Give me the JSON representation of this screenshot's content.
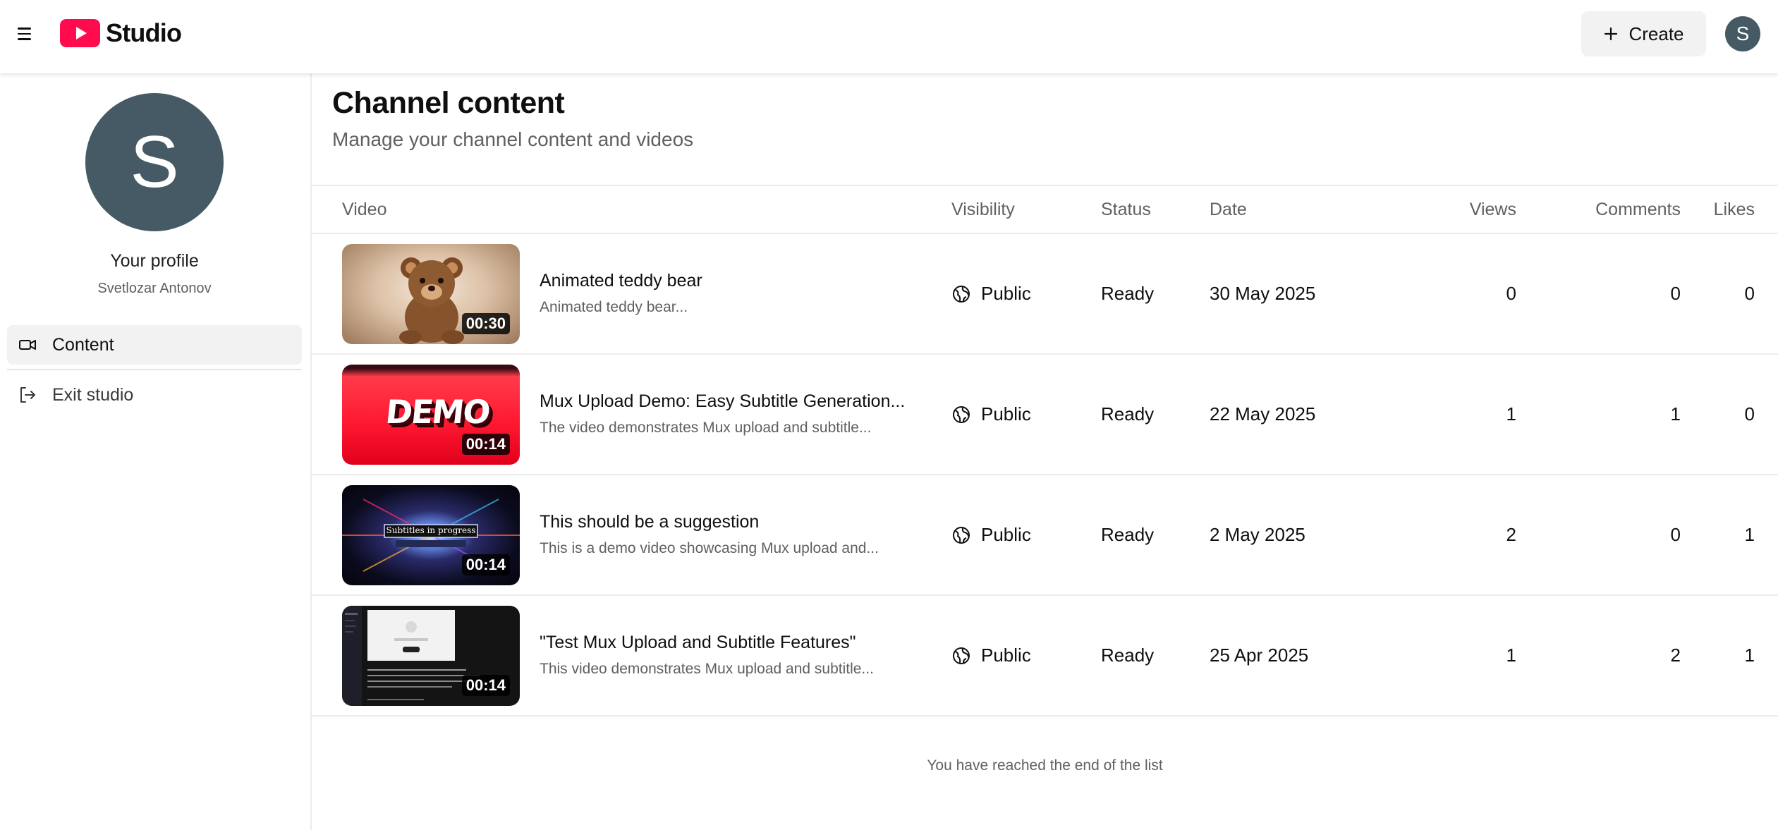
{
  "app": {
    "name": "Studio",
    "create_label": "Create",
    "avatar_initial": "S",
    "brand_color": "#ff0b4e",
    "avatar_color": "#455a64"
  },
  "sidebar": {
    "profile_initial": "S",
    "profile_label": "Your profile",
    "profile_name": "Svetlozar Antonov",
    "items": [
      {
        "label": "Content",
        "icon": "video-camera-icon",
        "active": true
      },
      {
        "label": "Exit studio",
        "icon": "exit-icon",
        "active": false
      }
    ]
  },
  "main": {
    "title": "Channel content",
    "subtitle": "Manage your channel content and videos",
    "columns": {
      "video": "Video",
      "visibility": "Visibility",
      "status": "Status",
      "date": "Date",
      "views": "Views",
      "comments": "Comments",
      "likes": "Likes"
    },
    "rows": [
      {
        "title": "Animated teddy bear",
        "description": "Animated teddy bear...",
        "duration": "00:30",
        "thumbnail": "teddy-bear-thumbnail",
        "visibility": "Public",
        "status": "Ready",
        "date": "30 May 2025",
        "views": "0",
        "comments": "0",
        "likes": "0"
      },
      {
        "title": "Mux Upload Demo: Easy Subtitle Generation...",
        "description": "The video demonstrates Mux upload and subtitle...",
        "duration": "00:14",
        "thumbnail": "demo-red-thumbnail",
        "thumbnail_text": "DEMO",
        "visibility": "Public",
        "status": "Ready",
        "date": "22 May 2025",
        "views": "1",
        "comments": "1",
        "likes": "0"
      },
      {
        "title": "This should be a suggestion",
        "description": "This is a demo video showcasing Mux upload and...",
        "duration": "00:14",
        "thumbnail": "subtitles-in-progress-thumbnail",
        "thumbnail_text": "Subtitles in progress",
        "visibility": "Public",
        "status": "Ready",
        "date": "2 May 2025",
        "views": "2",
        "comments": "0",
        "likes": "1"
      },
      {
        "title": "\"Test Mux Upload and Subtitle Features\"",
        "description": "This video demonstrates Mux upload and subtitle...",
        "duration": "00:14",
        "thumbnail": "screen-recording-thumbnail",
        "visibility": "Public",
        "status": "Ready",
        "date": "25 Apr 2025",
        "views": "1",
        "comments": "2",
        "likes": "1"
      }
    ],
    "end_note": "You have reached the end of the list"
  }
}
